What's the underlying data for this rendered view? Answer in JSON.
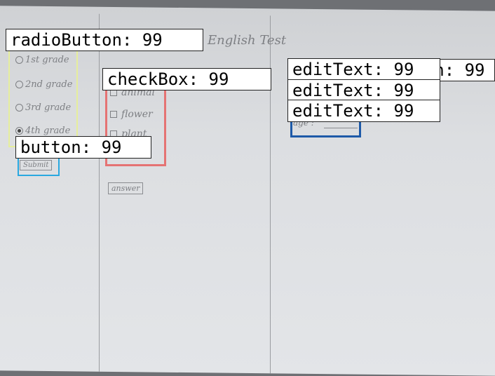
{
  "sketch": {
    "title": "English Test",
    "radios": [
      {
        "label": "1st grade",
        "selected": false
      },
      {
        "label": "2nd grade",
        "selected": false
      },
      {
        "label": "3rd grade",
        "selected": false
      },
      {
        "label": "4th grade",
        "selected": true
      }
    ],
    "submit_label": "Submit",
    "checkboxes": [
      "animal",
      "flower",
      "plant"
    ],
    "answer_label": "answer",
    "age_label": "age :"
  },
  "detections": {
    "radio": "radioButton: 99",
    "checkbox": "checkBox: 99",
    "button": "button: 99",
    "edit1": "editText: 99",
    "edit2": "editText: 99",
    "edit3": "editText: 99",
    "hidden_button": "button: 99"
  },
  "colors": {
    "radio_box": "#e6ee9c",
    "checkbox_box": "#e57373",
    "button_box": "#29a8e0",
    "edittext_box": "#1e5aa8"
  }
}
